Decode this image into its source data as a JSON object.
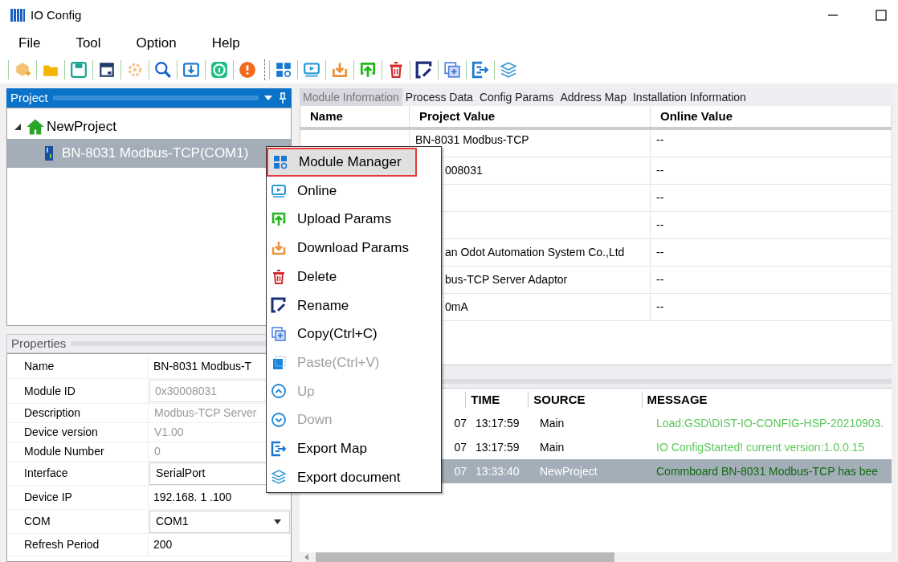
{
  "window": {
    "title": "IO Config"
  },
  "menu_bar": [
    "File",
    "Tool",
    "Option",
    "Help"
  ],
  "project_panel": {
    "title": "Project",
    "tree": [
      {
        "label": "NewProject",
        "expanded": true,
        "selected": false,
        "children": [
          {
            "label": "BN-8031 Modbus-TCP(COM1)",
            "selected": true
          }
        ]
      }
    ]
  },
  "properties_panel": {
    "title": "Properties",
    "rows": [
      {
        "label": "Name",
        "value": "BN-8031 Modbus-T",
        "kind": "text"
      },
      {
        "label": "Module ID",
        "value": "0x30008031",
        "kind": "readonly-box"
      },
      {
        "label": "Description",
        "value": "Modbus-TCP Server",
        "kind": "readonly"
      },
      {
        "label": "Device version",
        "value": "V1.00",
        "kind": "readonly"
      },
      {
        "label": "Module Number",
        "value": "0",
        "kind": "readonly"
      },
      {
        "label": "Interface",
        "value": "SerialPort",
        "kind": "box"
      },
      {
        "label": "Device IP",
        "value": "192.168. 1 .100",
        "kind": "text"
      },
      {
        "label": "COM",
        "value": "COM1",
        "kind": "dropdown"
      },
      {
        "label": "Refresh Period",
        "value": "200",
        "kind": "text"
      }
    ]
  },
  "tabs": [
    {
      "label": "Module Information",
      "selected": true
    },
    {
      "label": "Process Data",
      "selected": false
    },
    {
      "label": "Config Params",
      "selected": false
    },
    {
      "label": "Address Map",
      "selected": false
    },
    {
      "label": "Installation Information",
      "selected": false
    }
  ],
  "module_table": {
    "columns": [
      "Name",
      "Project Value",
      "Online Value"
    ],
    "rows": [
      [
        "",
        "BN-8031 Modbus-TCP",
        "--"
      ],
      [
        "",
        "008031",
        "--"
      ],
      [
        "",
        "",
        "--"
      ],
      [
        "",
        "",
        "--"
      ],
      [
        "",
        "an Odot Automation System Co.,Ltd",
        "--"
      ],
      [
        "",
        "bus-TCP Server Adaptor",
        "--"
      ],
      [
        "",
        "0mA",
        "--"
      ]
    ]
  },
  "log_table": {
    "columns": [
      "",
      "TIME",
      "SOURCE",
      "MESSAGE"
    ],
    "rows": [
      {
        "cells": [
          "07",
          "13:17:59",
          "Main",
          "Load:GSD\\DIST-IO-CONFIG-HSP-20210903."
        ],
        "selected": false
      },
      {
        "cells": [
          "07",
          "13:17:59",
          "Main",
          "IO ConfigStarted! current version:1.0.0.15"
        ],
        "selected": false
      },
      {
        "cells": [
          "07",
          "13:33:40",
          "NewProject",
          "Commboard BN-8031 Modbus-TCP has bee"
        ],
        "selected": true
      }
    ]
  },
  "context_menu": [
    {
      "label": "Module Manager",
      "selected": true,
      "disabled": false
    },
    {
      "label": "Online",
      "selected": false,
      "disabled": false
    },
    {
      "label": "Upload Params",
      "selected": false,
      "disabled": false
    },
    {
      "label": "Download Params",
      "selected": false,
      "disabled": false
    },
    {
      "label": "Delete",
      "selected": false,
      "disabled": false
    },
    {
      "label": "Rename",
      "selected": false,
      "disabled": false
    },
    {
      "label": "Copy(Ctrl+C)",
      "selected": false,
      "disabled": false
    },
    {
      "label": "Paste(Ctrl+V)",
      "selected": false,
      "disabled": true
    },
    {
      "label": "Up",
      "selected": false,
      "disabled": true
    },
    {
      "label": "Down",
      "selected": false,
      "disabled": true
    },
    {
      "label": "Export Map",
      "selected": false,
      "disabled": false
    },
    {
      "label": "Export document",
      "selected": false,
      "disabled": false
    }
  ]
}
